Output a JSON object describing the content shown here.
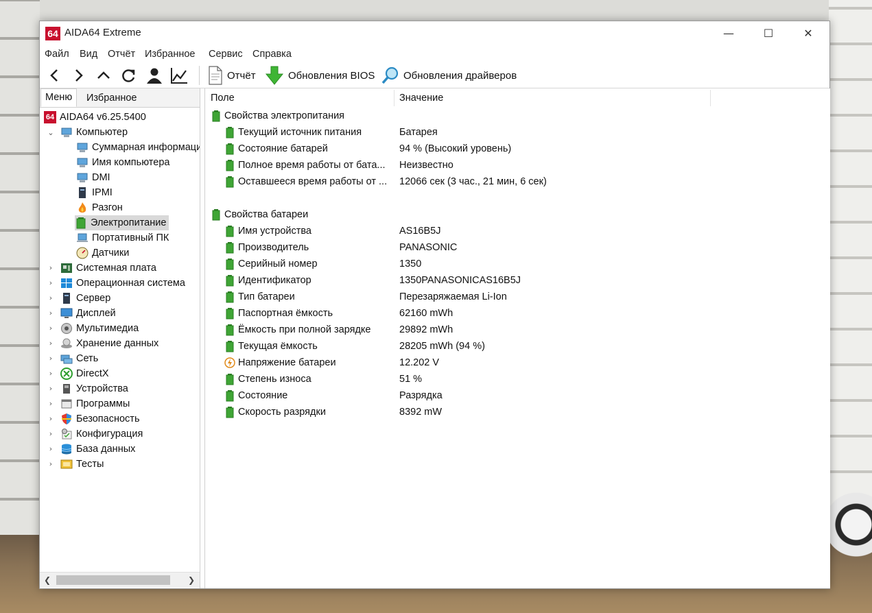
{
  "window": {
    "title": "AIDA64 Extreme",
    "logo_text": "64",
    "controls": {
      "minimize": "—",
      "maximize": "☐",
      "close": "✕"
    }
  },
  "menu": [
    "Файл",
    "Вид",
    "Отчёт",
    "Избранное",
    "Сервис",
    "Справка"
  ],
  "toolbar": {
    "report_label": "Отчёт",
    "bios_label": "Обновления BIOS",
    "drivers_label": "Обновления драйверов"
  },
  "left_tabs": [
    "Меню",
    "Избранное"
  ],
  "tree": {
    "root": "AIDA64 v6.25.5400",
    "computer": "Компьютер",
    "computer_children": [
      "Суммарная информация",
      "Имя компьютера",
      "DMI",
      "IPMI",
      "Разгон",
      "Электропитание",
      "Портативный ПК",
      "Датчики"
    ],
    "categories": [
      "Системная плата",
      "Операционная система",
      "Сервер",
      "Дисплей",
      "Мультимедиа",
      "Хранение данных",
      "Сеть",
      "DirectX",
      "Устройства",
      "Программы",
      "Безопасность",
      "Конфигурация",
      "База данных",
      "Тесты"
    ]
  },
  "columns": {
    "field": "Поле",
    "value": "Значение"
  },
  "sections": [
    {
      "title": "Свойства электропитания",
      "rows": [
        {
          "field": "Текущий источник питания",
          "value": "Батарея"
        },
        {
          "field": "Состояние батарей",
          "value": "94 % (Высокий уровень)"
        },
        {
          "field": "Полное время работы от бата...",
          "value": "Неизвестно"
        },
        {
          "field": "Оставшееся время работы от ...",
          "value": "12066 сек (3 час., 21 мин, 6 сек)"
        }
      ]
    },
    {
      "title": "Свойства батареи",
      "rows": [
        {
          "field": "Имя устройства",
          "value": "AS16B5J"
        },
        {
          "field": "Производитель",
          "value": "PANASONIC"
        },
        {
          "field": "Серийный номер",
          "value": "1350"
        },
        {
          "field": "Идентификатор",
          "value": "1350PANASONICAS16B5J"
        },
        {
          "field": "Тип батареи",
          "value": "Перезаряжаемая Li-Ion"
        },
        {
          "field": "Паспортная ёмкость",
          "value": "62160 mWh"
        },
        {
          "field": "Ёмкость при полной зарядке",
          "value": "29892 mWh"
        },
        {
          "field": "Текущая ёмкость",
          "value": "28205 mWh  (94 %)"
        },
        {
          "field": "Напряжение батареи",
          "value": "12.202 V"
        },
        {
          "field": "Степень износа",
          "value": "51 %"
        },
        {
          "field": "Состояние",
          "value": "Разрядка"
        },
        {
          "field": "Скорость разрядки",
          "value": "8392 mW"
        }
      ]
    }
  ],
  "colors": {
    "accent_red": "#c8102e",
    "battery_green": "#3fa535",
    "selection": "#d9d9d9"
  }
}
